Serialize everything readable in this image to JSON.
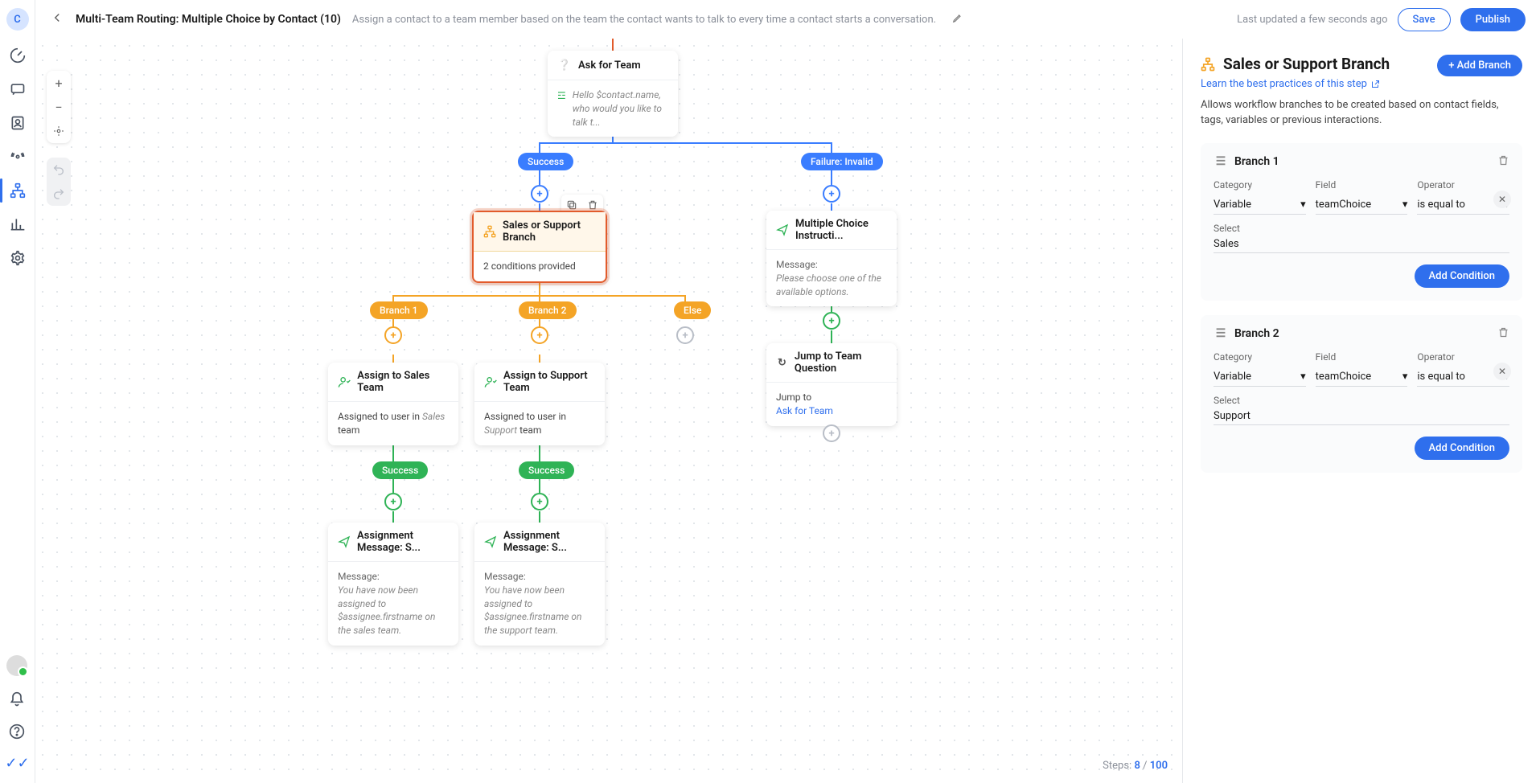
{
  "header": {
    "title": "Multi-Team Routing: Multiple Choice by Contact (10)",
    "description": "Assign a contact to a team member based on the team the contact wants to talk to every time a contact starts a conversation.",
    "last_updated": "Last updated a few seconds ago",
    "save_label": "Save",
    "publish_label": "Publish"
  },
  "avatar_letter": "C",
  "steps": {
    "prefix": "Steps:",
    "used": "8",
    "sep": "/",
    "total": "100"
  },
  "nodes": {
    "ask": {
      "title": "Ask for Team",
      "body": "Hello $contact.name, who would you like to talk t..."
    },
    "branch": {
      "title": "Sales or Support Branch",
      "body": "2 conditions provided"
    },
    "mc": {
      "title": "Multiple Choice Instructi...",
      "msg_label": "Message:",
      "msg": "Please choose one of the available options."
    },
    "jump": {
      "title": "Jump to Team Question",
      "label": "Jump to",
      "target": "Ask for Team"
    },
    "assign_sales": {
      "title": "Assign to Sales Team",
      "pre": "Assigned to user in ",
      "team_italic": "Sales",
      "post": " team"
    },
    "assign_support": {
      "title": "Assign to Support Team",
      "pre": "Assigned to user in ",
      "team_italic": "Support",
      "post": " team"
    },
    "msg_sales": {
      "title": "Assignment Message: S...",
      "msg_label": "Message:",
      "msg": "You have now been assigned to $assignee.firstname on the sales team."
    },
    "msg_support": {
      "title": "Assignment Message: S...",
      "msg_label": "Message:",
      "msg": "You have now been assigned to $assignee.firstname on the support team."
    }
  },
  "pills": {
    "success1": "Success",
    "failure": "Failure: Invalid",
    "branch1": "Branch 1",
    "branch2": "Branch 2",
    "else": "Else",
    "success2": "Success",
    "success3": "Success"
  },
  "panel": {
    "title": "Sales or Support Branch",
    "learn": "Learn the best practices of this step",
    "add_branch": "+ Add Branch",
    "description": "Allows workflow branches to be created based on contact fields, tags, variables or previous interactions.",
    "labels": {
      "category": "Category",
      "field": "Field",
      "operator": "Operator",
      "select": "Select"
    },
    "add_condition": "Add Condition",
    "branches": [
      {
        "name": "Branch 1",
        "category": "Variable",
        "field": "teamChoice",
        "operator": "is equal to",
        "value": "Sales"
      },
      {
        "name": "Branch 2",
        "category": "Variable",
        "field": "teamChoice",
        "operator": "is equal to",
        "value": "Support"
      }
    ]
  }
}
